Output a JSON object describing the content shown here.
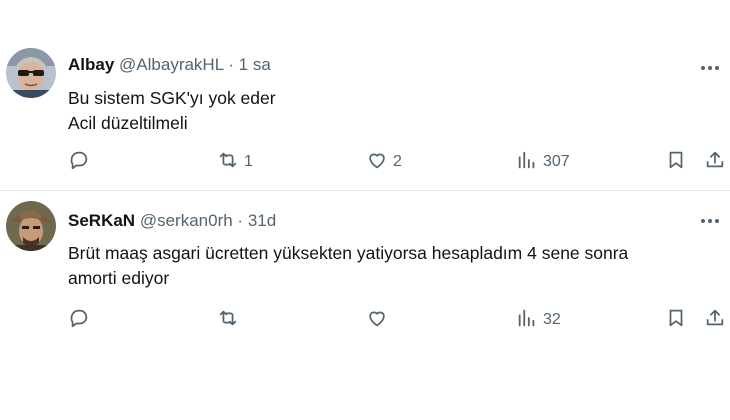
{
  "tweets": [
    {
      "name": "Albay",
      "handle": "@AlbayrakHL",
      "sep": "·",
      "time": "1 sa",
      "lines": [
        "Bu sistem SGK'yı yok eder",
        "Acil düzeltilmeli"
      ],
      "retweets": "1",
      "likes": "2",
      "views": "307"
    },
    {
      "name": "SeRKaN",
      "handle": "@serkan0rh",
      "sep": "·",
      "time": "31d",
      "lines": [
        "Brüt maaş asgari ücretten yüksekten yatiyorsa hesapladım 4 sene sonra",
        "amorti ediyor"
      ],
      "retweets": "",
      "likes": "",
      "views": "32"
    }
  ],
  "icons": [
    "more-icon",
    "reply-icon",
    "retweet-icon",
    "like-icon",
    "views-icon",
    "bookmark-icon",
    "share-icon"
  ],
  "colors": {
    "text": "#0f1419",
    "secondary": "#536471",
    "divider": "#e4e8ea"
  }
}
